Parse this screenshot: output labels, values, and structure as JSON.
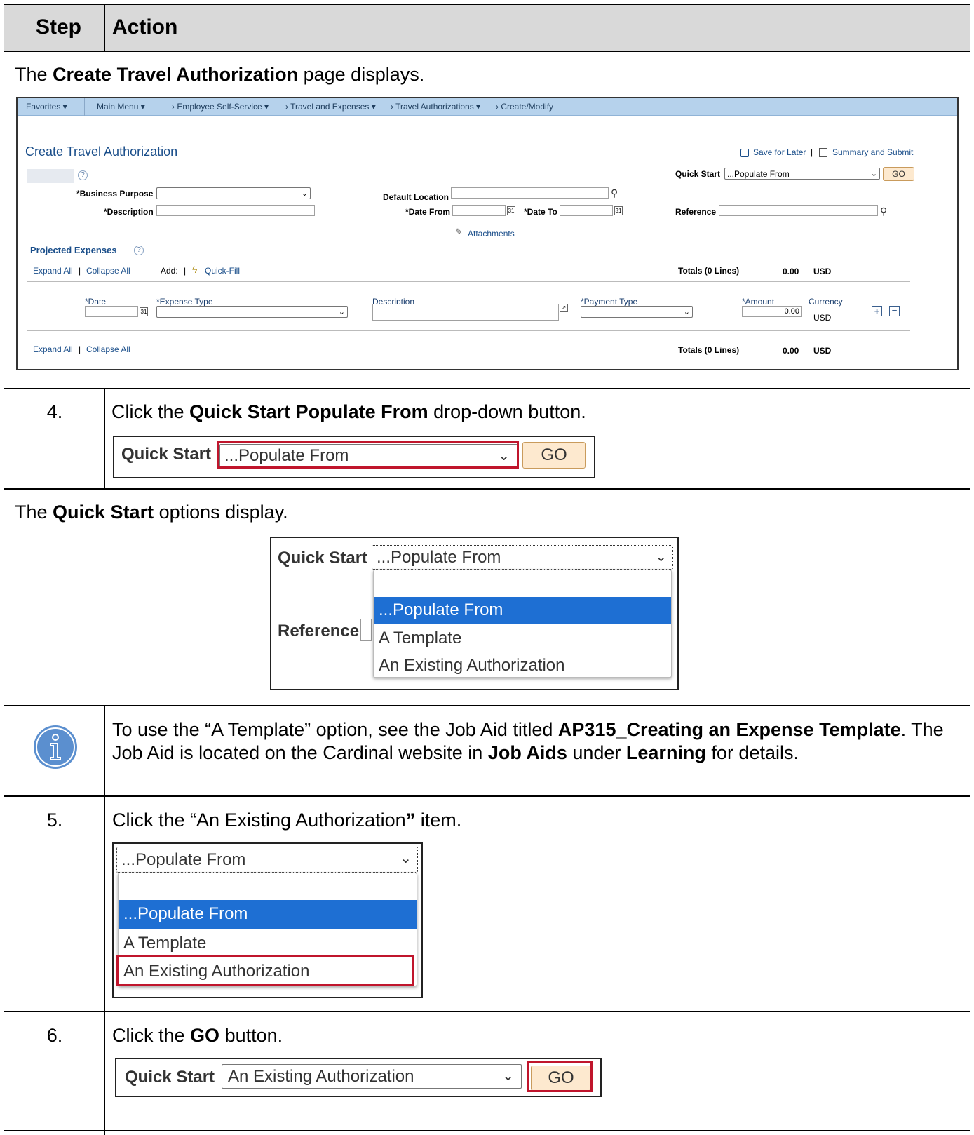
{
  "header": {
    "step": "Step",
    "action": "Action"
  },
  "s1": {
    "pre": "The ",
    "bold": "Create Travel Authorization",
    "post": " page displays."
  },
  "ps": {
    "nav": {
      "favorites": "Favorites ▾",
      "main_menu": "Main Menu ▾",
      "ess": "›  Employee Self-Service ▾",
      "te": "›  Travel and Expenses ▾",
      "ta": "›  Travel Authorizations ▾",
      "cm": "›  Create/Modify"
    },
    "title": "Create Travel Authorization",
    "save_later": "Save for Later",
    "sep": "|",
    "summary": "Summary and Submit",
    "quick_start_label": "Quick Start",
    "quick_start_value": "...Populate From",
    "go": "GO",
    "business_purpose": "*Business Purpose",
    "description": "*Description",
    "default_location": "Default Location",
    "date_from": "*Date From",
    "date_to": "*Date To",
    "reference": "Reference",
    "attachments": "Attachments",
    "projected_expenses": "Projected Expenses",
    "expand_all": "Expand All",
    "collapse_all": "Collapse All",
    "add": "Add:",
    "quick_fill": "Quick-Fill",
    "totals": "Totals (0 Lines)",
    "total_value": "0.00",
    "currency_code": "USD",
    "col_date": "*Date",
    "col_expense_type": "*Expense Type",
    "col_description": "Description",
    "col_payment_type": "*Payment Type",
    "col_amount": "*Amount",
    "col_currency": "Currency",
    "amount_value": "0.00",
    "row_currency": "USD"
  },
  "s2": {
    "num": "4.",
    "pre": "Click the ",
    "bold": "Quick Start Populate From",
    "post": " drop-down button."
  },
  "qs1": {
    "label": "Quick Start",
    "value": "...Populate From",
    "go": "GO"
  },
  "s3": {
    "pre": "The ",
    "bold": "Quick Start",
    "post": " options display."
  },
  "qs2": {
    "label": "Quick Start",
    "value": "...Populate From",
    "reference": "Reference",
    "options": [
      "",
      "...Populate From",
      "A Template",
      "An Existing Authorization"
    ]
  },
  "s4": {
    "t1": "To use the “A Template” option, see the Job Aid titled ",
    "b1": "AP315_Creating an Expense Template",
    "t2": ".  The Job Aid is located on the Cardinal website in ",
    "b2": "Job Aids",
    "t3": " under ",
    "b3": "Learning",
    "t4": " for details."
  },
  "s5": {
    "num": "5.",
    "text": "Click the “An Existing Authorization",
    "close": "”",
    "post": " item."
  },
  "qs3": {
    "value": "...Populate From",
    "options": [
      "",
      "...Populate From",
      "A Template",
      "An Existing Authorization"
    ]
  },
  "s6": {
    "num": "6.",
    "pre": "Click the ",
    "bold": "GO",
    "post": " button."
  },
  "qs4": {
    "label": "Quick Start",
    "value": "An Existing Authorization",
    "go": "GO"
  },
  "colors": {
    "header_bg": "#d9d9d9",
    "highlight": "#c0152c",
    "selected": "#1e6fd3",
    "nav": "#b6d2ec",
    "go_bg": "#fde9cf",
    "info": "#5b8fcf"
  }
}
